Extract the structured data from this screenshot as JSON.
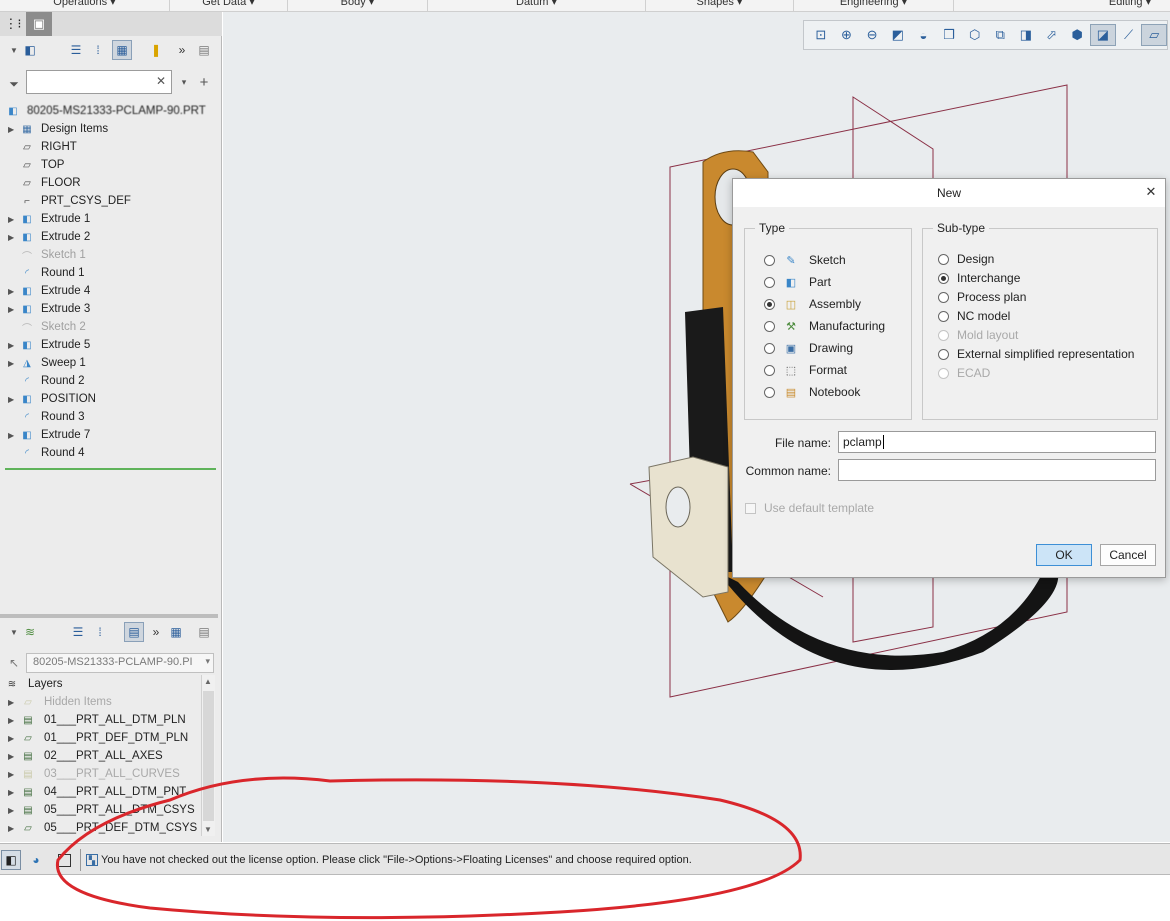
{
  "ribbon": {
    "groups": [
      "Operations",
      "Get Data",
      "Body",
      "Datum",
      "Shapes",
      "Engineering",
      "Editing"
    ]
  },
  "model_tree": {
    "root_label": "80205-MS21333-PCLAMP-90.PRT",
    "search_placeholder": "",
    "items": [
      {
        "label": "Design Items",
        "icon": "design-items-icon",
        "expandable": true,
        "dim": false
      },
      {
        "label": "RIGHT",
        "icon": "datum-plane-icon",
        "expandable": false,
        "dim": false
      },
      {
        "label": "TOP",
        "icon": "datum-plane-icon",
        "expandable": false,
        "dim": false
      },
      {
        "label": "FLOOR",
        "icon": "datum-plane-icon",
        "expandable": false,
        "dim": false
      },
      {
        "label": "PRT_CSYS_DEF",
        "icon": "csys-icon",
        "expandable": false,
        "dim": false
      },
      {
        "label": "Extrude 1",
        "icon": "extrude-icon",
        "expandable": true,
        "dim": false
      },
      {
        "label": "Extrude 2",
        "icon": "extrude-icon",
        "expandable": true,
        "dim": false
      },
      {
        "label": "Sketch 1",
        "icon": "sketch-icon",
        "expandable": false,
        "dim": true
      },
      {
        "label": "Round 1",
        "icon": "round-icon",
        "expandable": false,
        "dim": false
      },
      {
        "label": "Extrude 4",
        "icon": "extrude-icon",
        "expandable": true,
        "dim": false
      },
      {
        "label": "Extrude 3",
        "icon": "extrude-icon",
        "expandable": true,
        "dim": false
      },
      {
        "label": "Sketch 2",
        "icon": "sketch-icon",
        "expandable": false,
        "dim": true
      },
      {
        "label": "Extrude 5",
        "icon": "extrude-icon",
        "expandable": true,
        "dim": false
      },
      {
        "label": "Sweep 1",
        "icon": "sweep-icon",
        "expandable": true,
        "dim": false
      },
      {
        "label": "Round 2",
        "icon": "round-icon",
        "expandable": false,
        "dim": false
      },
      {
        "label": "POSITION",
        "icon": "extrude-icon",
        "expandable": true,
        "dim": false
      },
      {
        "label": "Round 3",
        "icon": "round-icon",
        "expandable": false,
        "dim": false
      },
      {
        "label": "Extrude 7",
        "icon": "extrude-icon",
        "expandable": true,
        "dim": false
      },
      {
        "label": "Round 4",
        "icon": "round-icon",
        "expandable": false,
        "dim": false
      }
    ]
  },
  "layer_tree": {
    "model_select": "80205-MS21333-PCLAMP-90.PI",
    "header": "Layers",
    "items": [
      {
        "label": "Hidden Items",
        "dim": true
      },
      {
        "label": "01___PRT_ALL_DTM_PLN",
        "dim": false
      },
      {
        "label": "01___PRT_DEF_DTM_PLN",
        "dim": false
      },
      {
        "label": "02___PRT_ALL_AXES",
        "dim": false
      },
      {
        "label": "03___PRT_ALL_CURVES",
        "dim": true
      },
      {
        "label": "04___PRT_ALL_DTM_PNT",
        "dim": false
      },
      {
        "label": "05___PRT_ALL_DTM_CSYS",
        "dim": false
      },
      {
        "label": "05___PRT_DEF_DTM_CSYS",
        "dim": false
      }
    ]
  },
  "dialog": {
    "title": "New",
    "type_group_label": "Type",
    "subtype_group_label": "Sub-type",
    "types": [
      {
        "label": "Sketch",
        "selected": false,
        "icon": "sketch-type-icon"
      },
      {
        "label": "Part",
        "selected": false,
        "icon": "part-type-icon"
      },
      {
        "label": "Assembly",
        "selected": true,
        "icon": "assembly-type-icon"
      },
      {
        "label": "Manufacturing",
        "selected": false,
        "icon": "manufacturing-type-icon"
      },
      {
        "label": "Drawing",
        "selected": false,
        "icon": "drawing-type-icon"
      },
      {
        "label": "Format",
        "selected": false,
        "icon": "format-type-icon"
      },
      {
        "label": "Notebook",
        "selected": false,
        "icon": "notebook-type-icon"
      }
    ],
    "subtypes": [
      {
        "label": "Design",
        "selected": false,
        "disabled": false
      },
      {
        "label": "Interchange",
        "selected": true,
        "disabled": false
      },
      {
        "label": "Process plan",
        "selected": false,
        "disabled": false
      },
      {
        "label": "NC model",
        "selected": false,
        "disabled": false
      },
      {
        "label": "Mold layout",
        "selected": false,
        "disabled": true
      },
      {
        "label": "External simplified representation",
        "selected": false,
        "disabled": false
      },
      {
        "label": "ECAD",
        "selected": false,
        "disabled": true
      }
    ],
    "file_name_label": "File name:",
    "file_name_value": "pclamp",
    "common_name_label": "Common name:",
    "common_name_value": "",
    "use_default_template_label": "Use default template",
    "ok_label": "OK",
    "cancel_label": "Cancel"
  },
  "status_bar": {
    "message": "You have not checked out the license option. Please click \"File->Options->Floating Licenses\" and choose required option."
  },
  "colors": {
    "annotation": "#d9262b",
    "accent": "#3d8fd6"
  }
}
